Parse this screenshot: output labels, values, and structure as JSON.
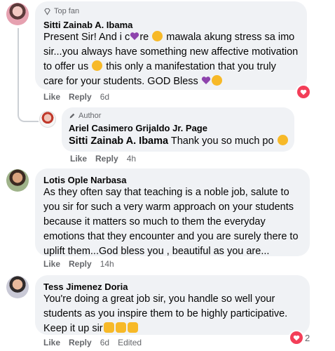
{
  "comments": [
    {
      "badge": "Top fan",
      "author": "Sitti Zainab A. Ibama",
      "text_lines": [
        "Present Sir! And i c",
        "re",
        " mawala akung stress sa imo",
        "sir...you always have something new affective motivation",
        "to offer us ",
        " this only a manifestation that you truly",
        "care for your students. GOD Bless "
      ],
      "actions": [
        "Like",
        "Reply",
        "6d"
      ],
      "reaction_icon": "heart-icon"
    },
    {
      "badge": "Author",
      "author": "Ariel Casimero Grijaldo Jr. Page",
      "mention": "Sitti Zainab A. Ibama",
      "text": " Thank you so much po ",
      "actions": [
        "Like",
        "Reply",
        "4h"
      ]
    },
    {
      "author": "Lotis Ople Narbasa",
      "text_lines": [
        "As they often say that teaching is a noble job, salute to",
        "you sir for such a very warm approach on your students",
        "because it matters so much to them the everyday",
        "emotions that they encounter and you are surely there to",
        "uplift them...God bless you , beautiful as you are..."
      ],
      "actions": [
        "Like",
        "Reply",
        "14h"
      ]
    },
    {
      "author": "Tess Jimenez Doria",
      "text_lines": [
        "You're doing a great job sir, you handle so well your",
        "students as you inspire them to be highly participative.",
        "Keep it up sir"
      ],
      "actions": [
        "Like",
        "Reply",
        "6d",
        "Edited"
      ],
      "reaction_icon": "heart-icon",
      "reaction_count": "2"
    }
  ],
  "colors": {
    "bubble": "#f0f2f5",
    "meta": "#65676b",
    "heart": "#f33e58",
    "emoji": "#f7b928",
    "purple_heart": "#8e44ad"
  }
}
